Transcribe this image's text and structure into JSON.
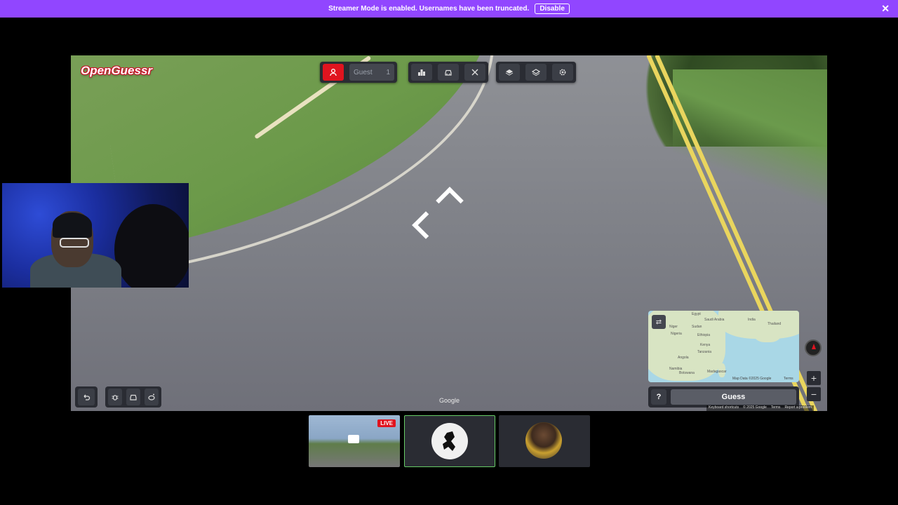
{
  "banner": {
    "message": "Streamer Mode is enabled. Usernames have been truncated.",
    "disable_label": "Disable"
  },
  "app": {
    "logo": "OpenGuessr",
    "player_name": "Guest",
    "player_count": "1",
    "google_mark": "Google"
  },
  "toolbar": {
    "icons": [
      "user-icon",
      "podium-icon",
      "car-icon",
      "crossed-swords-icon",
      "layers-icon",
      "layers-alt-icon",
      "gear-icon"
    ]
  },
  "bottom_left": {
    "icons": [
      "undo-icon",
      "bug-icon",
      "car-icon",
      "reddit-icon"
    ]
  },
  "minimap": {
    "labels": [
      "Egypt",
      "Saudi Arabia",
      "Niger",
      "Sudan",
      "India",
      "Thailand",
      "Nigeria",
      "Ethiopia",
      "Kenya",
      "Tanzania",
      "Angola",
      "Namibia",
      "Botswana",
      "Madagascar"
    ],
    "credit": "Map Data ©2025 Google",
    "terms": "Terms"
  },
  "guess": {
    "help_label": "?",
    "guess_label": "Guess"
  },
  "zoom": {
    "plus": "+",
    "minus": "−"
  },
  "footer": {
    "shortcuts": "Keyboard shortcuts",
    "copyright": "© 2025 Google",
    "terms": "Terms",
    "report": "Report a problem"
  },
  "thumbnails": {
    "live_label": "LIVE"
  }
}
